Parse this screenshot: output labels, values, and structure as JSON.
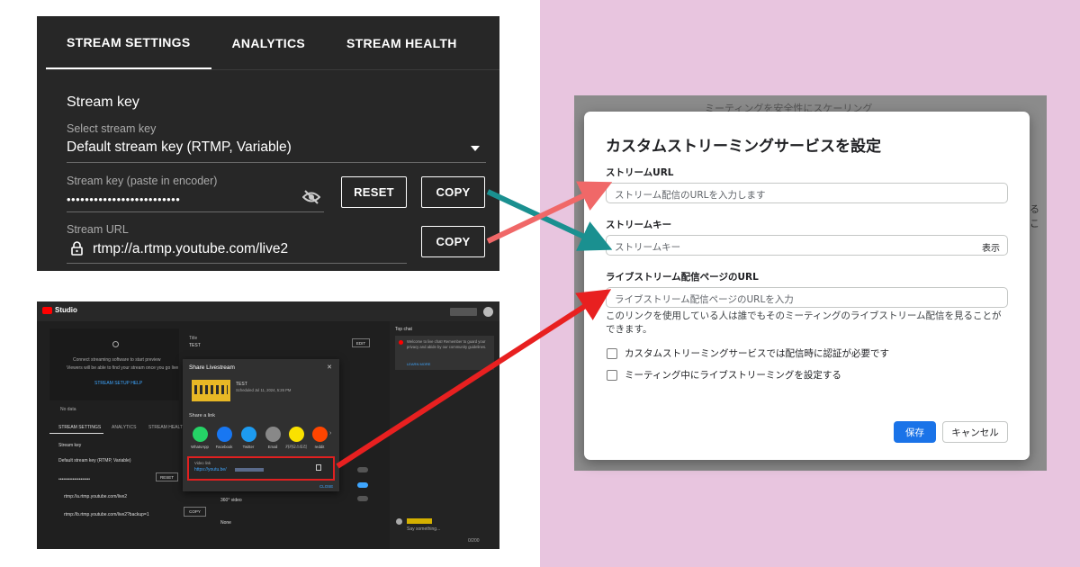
{
  "colors": {
    "pink_background": "#e8c5df",
    "dark_panel": "#272727",
    "arrow_teal": "#1a9090",
    "arrow_coral": "#f06868",
    "arrow_red": "#e82020",
    "save_blue": "#1a73e8"
  },
  "stream_settings": {
    "tabs": [
      "STREAM SETTINGS",
      "ANALYTICS",
      "STREAM HEALTH"
    ],
    "section_title": "Stream key",
    "select_label": "Select stream key",
    "select_value": "Default stream key (RTMP, Variable)",
    "key_label": "Stream key (paste in encoder)",
    "key_value": "•••••••••••••••••••••••••",
    "reset_label": "RESET",
    "copy_key_label": "COPY",
    "url_label": "Stream URL",
    "url_value": "rtmp://a.rtmp.youtube.com/live2",
    "copy_url_label": "COPY",
    "icons": [
      "visibility-off-icon",
      "dropdown-arrow-icon",
      "lock-icon"
    ]
  },
  "studio": {
    "logo_text": "Studio",
    "preview_line1": "Connect streaming software to start preview",
    "preview_line2": "Viewers will be able to find your stream once you go live",
    "setup_help": "STREAM SETUP HELP",
    "no_data": "No data",
    "tabs": [
      "STREAM SETTINGS",
      "ANALYTICS",
      "STREAM HEALTH"
    ],
    "title_label": "Title",
    "title_value": "TEST",
    "edit_label": "EDIT",
    "stream_key_heading": "Stream key",
    "select_key_value": "Default stream key (RTMP, Variable)",
    "key_mask": "••••••••••••••••••••",
    "reset_label": "RESET",
    "url_value": "rtmp://a.rtmp.youtube.com/live2",
    "backup_url_value": "rtmp://b.rtmp.youtube.com/live2?backup=1",
    "copy_label": "COPY",
    "top_chat": "Top chat",
    "chat_welcome": "Welcome to live chat! Remember to guard your privacy and abide by our community guidelines.",
    "learn_more": "LEARN MORE",
    "video_360": "360° video",
    "none_label": "None",
    "say_something": "Say something...",
    "char_count": "0/200",
    "share": {
      "title": "Share Livestream",
      "video_title": "TEST",
      "scheduled": "Scheduled Jul 11, 2024, 5:26 PM",
      "share_link": "Share a link",
      "socials": [
        "WhatsApp",
        "Facebook",
        "Twitter",
        "Email",
        "카카오스토리",
        "reddit"
      ],
      "video_link_label": "Video link",
      "video_link": "https://youtu.be/",
      "close_label": "CLOSE"
    }
  },
  "dialog": {
    "bg_header": "ミーティングを安全性にスケーリング",
    "bg_side_text": "るこ",
    "heading": "カスタムストリーミングサービスを設定",
    "url_label": "ストリームURL",
    "url_placeholder": "ストリーム配信のURLを入力します",
    "key_label": "ストリームキー",
    "key_placeholder": "ストリームキー",
    "key_show": "表示",
    "page_label": "ライブストリーム配信ページのURL",
    "page_placeholder": "ライブストリーム配信ページのURLを入力",
    "help_text": "このリンクを使用している人は誰でもそのミーティングのライブストリーム配信を見ることができます。",
    "check1": "カスタムストリーミングサービスでは配信時に認証が必要です",
    "check2": "ミーティング中にライブストリーミングを設定する",
    "save": "保存",
    "cancel": "キャンセル"
  }
}
